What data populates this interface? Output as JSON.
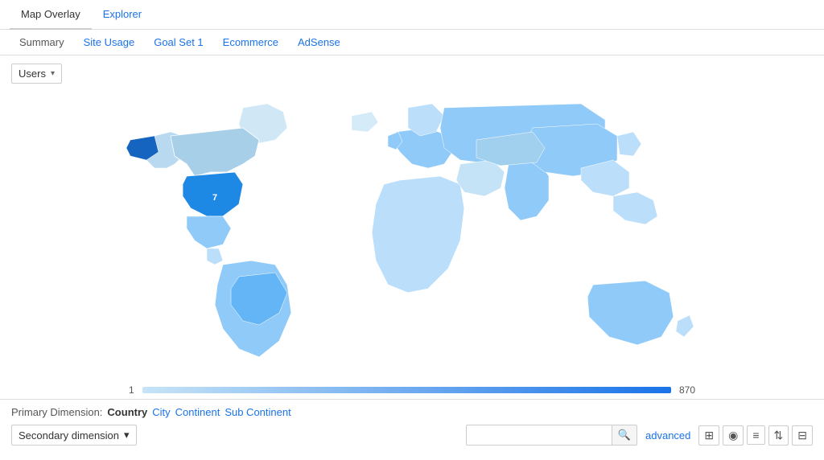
{
  "tabs": {
    "top": [
      {
        "id": "map-overlay",
        "label": "Map Overlay",
        "active": true,
        "blue": false
      },
      {
        "id": "explorer",
        "label": "Explorer",
        "active": false,
        "blue": true
      }
    ],
    "sub": [
      {
        "id": "summary",
        "label": "Summary",
        "active": true
      },
      {
        "id": "site-usage",
        "label": "Site Usage",
        "active": false
      },
      {
        "id": "goal-set-1",
        "label": "Goal Set 1",
        "active": false
      },
      {
        "id": "ecommerce",
        "label": "Ecommerce",
        "active": false
      },
      {
        "id": "adsense",
        "label": "AdSense",
        "active": false
      }
    ]
  },
  "controls": {
    "dropdown_label": "Users",
    "dropdown_arrow": "▾"
  },
  "legend": {
    "min": "1",
    "max": "870"
  },
  "primary_dimension": {
    "label": "Primary Dimension:",
    "active": "Country",
    "links": [
      "City",
      "Continent",
      "Sub Continent"
    ]
  },
  "secondary": {
    "label": "Secondary dimension",
    "arrow": "▾"
  },
  "toolbar": {
    "search_placeholder": "",
    "advanced_label": "advanced",
    "icons": [
      "⊞",
      "◉",
      "≡",
      "⇅",
      "⊟"
    ]
  }
}
